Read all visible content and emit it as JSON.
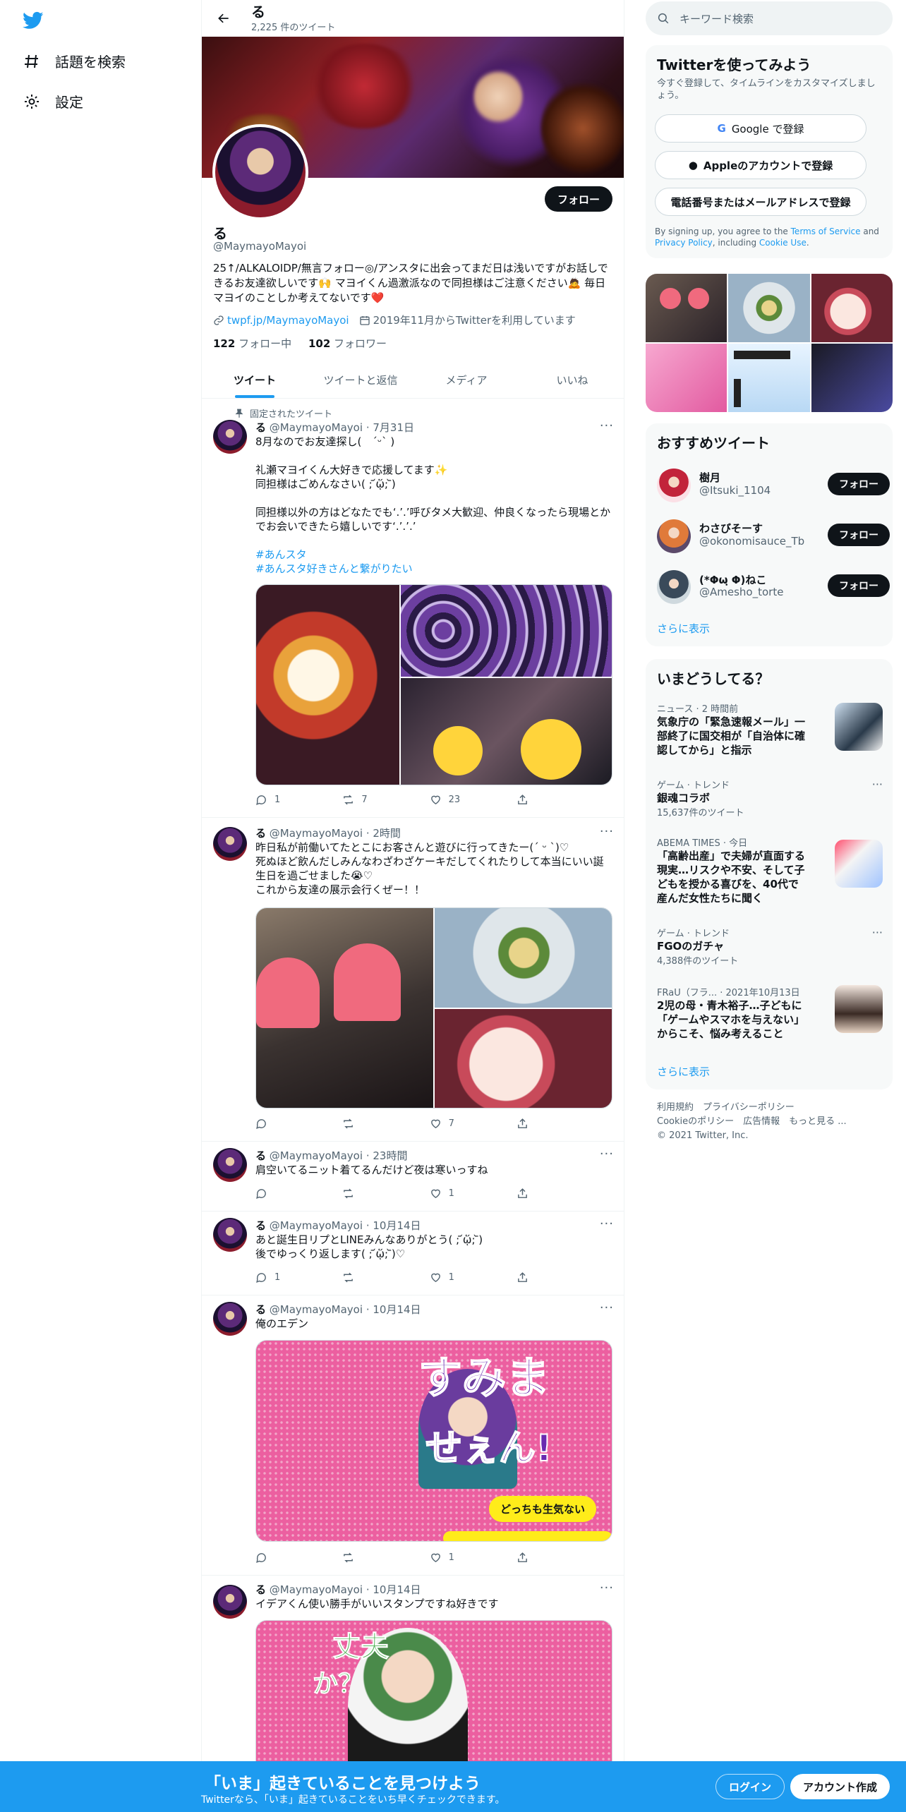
{
  "nav": {
    "explore_label": "話題を検索",
    "settings_label": "設定"
  },
  "header": {
    "name": "る",
    "tweet_count": "2,225 件のツイート"
  },
  "profile": {
    "follow_label": "フォロー",
    "name": "る",
    "handle": "@MaymayoMayoi",
    "bio_line1": "25↑/ALKALOIDP/無言フォロー◎/アンスタに出会ってまだ日は浅いですがお話しで",
    "bio_line2": "きるお友達欲しいです🙌 マヨイくん過激派なので同担様はご注意ください🙇 毎日",
    "bio_line3": "マヨイのことしか考えてないです❤️",
    "link": "twpf.jp/MaymayoMayoi",
    "joined": "2019年11月からTwitterを利用しています",
    "following_count": "122",
    "following_label": "フォロー中",
    "followers_count": "102",
    "followers_label": "フォロワー"
  },
  "tabs": [
    "ツイート",
    "ツイートと返信",
    "メディア",
    "いいね"
  ],
  "pinned_label": "固定されたツイート",
  "tweets": [
    {
      "name": "る",
      "handle": "@MaymayoMayoi",
      "time": "7月31日",
      "text": "8月なのでお友達探し(　ˊᵕˋ )\n\n礼瀬マヨイくん大好きで応援してます✨\n同担様はごめんなさい( ; ᷄ᾥ; ᷅)\n\n同担様以外の方はどなたでも‘.’.’呼びタメ大歓迎、仲良くなったら現場とか\nでお会いできたら嬉しいです‘.’.’.’",
      "hashtag1": "#あんスタ",
      "hashtag2": "#あんスタ好きさんと繋がりたい",
      "replies": "1",
      "retweets": "7",
      "likes": "23"
    },
    {
      "name": "る",
      "handle": "@MaymayoMayoi",
      "time": "2時間",
      "text": "昨日私が前働いてたとこにお客さんと遊びに行ってきたー(ˊ ᵕ ˋ)♡\n死ぬほど飲んだしみんなわざわざケーキだしてくれたりして本当にいい誕\n生日を過ごせました😭♡\nこれから友達の展示会行くぜー！！",
      "replies": "",
      "retweets": "",
      "likes": "7"
    },
    {
      "name": "る",
      "handle": "@MaymayoMayoi",
      "time": "23時間",
      "text": "肩空いてるニット着てるんだけど夜は寒いっすね",
      "replies": "",
      "retweets": "",
      "likes": "1"
    },
    {
      "name": "る",
      "handle": "@MaymayoMayoi",
      "time": "10月14日",
      "text": "あと誕生日リプとLINEみんなありがとう( ; ᷄ᾥ; ᷅)\n後でゆっくり返します( ; ᷄ᾥ; ᷅)♡",
      "replies": "1",
      "retweets": "",
      "likes": "1"
    },
    {
      "name": "る",
      "handle": "@MaymayoMayoi",
      "time": "10月14日",
      "text": "俺のエデン",
      "media_text1": "すみま",
      "media_text2": "せぇん!",
      "media_bubble": "どっちも生気ない",
      "replies": "",
      "retweets": "",
      "likes": "1"
    },
    {
      "name": "る",
      "handle": "@MaymayoMayoi",
      "time": "10月14日",
      "text": "イデアくん使い勝手がいいスタンプですね好きです",
      "media_text1": "丈夫",
      "media_text2": "か？"
    }
  ],
  "right": {
    "search_placeholder": "キーワード検索",
    "signup": {
      "title": "Twitterを使ってみよう",
      "subtitle": "今すぐ登録して、タイムラインをカスタマイズしましょう。",
      "google": "Google で登録",
      "apple": "Appleのアカウントで登録",
      "phone": "電話番号またはメールアドレスで登録",
      "terms_prefix": "By signing up, you agree to the ",
      "terms_link": "Terms of Service",
      "terms_and": " and ",
      "privacy_link": "Privacy Policy",
      "terms_incl": ", including ",
      "cookie_link": "Cookie Use",
      "terms_end": "."
    },
    "recommend": {
      "title": "おすすめツイート",
      "items": [
        {
          "name": "樹月",
          "handle": "@Itsuki_1104",
          "button": "フォロー"
        },
        {
          "name": "わさびそーす",
          "handle": "@okonomisauce_Tb",
          "button": "フォロー"
        },
        {
          "name": "(*Φωฺ Φ)ねこ",
          "handle": "@Amesho_torte",
          "button": "フォロー"
        }
      ],
      "more": "さらに表示"
    },
    "trends": {
      "title": "いまどうしてる？",
      "items": [
        {
          "context": "ニュース · 2 時間前",
          "title": "気象庁の「緊急速報メール」一部終了に国交相が「自治体に確認してから」と指示",
          "count": ""
        },
        {
          "context": "ゲーム · トレンド",
          "title": "銀魂コラボ",
          "count": "15,637件のツイート"
        },
        {
          "context": "ABEMA TIMES · 今日",
          "title": "「高齢出産」で夫婦が直面する現実…リスクや不安、そして子どもを授かる喜びを、40代で産んだ女性たちに聞く",
          "count": ""
        },
        {
          "context": "ゲーム · トレンド",
          "title": "FGOのガチャ",
          "count": "4,388件のツイート"
        },
        {
          "context": "FRaU（フラ... · 2021年10月13日",
          "title": "2児の母・青木裕子…子どもに「ゲームやスマホを与えない」からこそ、悩み考えること",
          "count": ""
        }
      ],
      "more": "さらに表示"
    },
    "footer": {
      "line1": "利用規約　プライバシーポリシー",
      "line2": "Cookieのポリシー　広告情報　もっと見る ...",
      "line3": "© 2021 Twitter, Inc."
    }
  },
  "bottom": {
    "headline": "「いま」起きていることを見つけよう",
    "sub": "Twitterなら、「いま」起きていることをいち早くチェックできます。",
    "login": "ログイン",
    "signup": "アカウント作成"
  },
  "colors": {
    "accent": "#1d9bf0",
    "dark": "#0f1419",
    "muted": "#536471"
  }
}
